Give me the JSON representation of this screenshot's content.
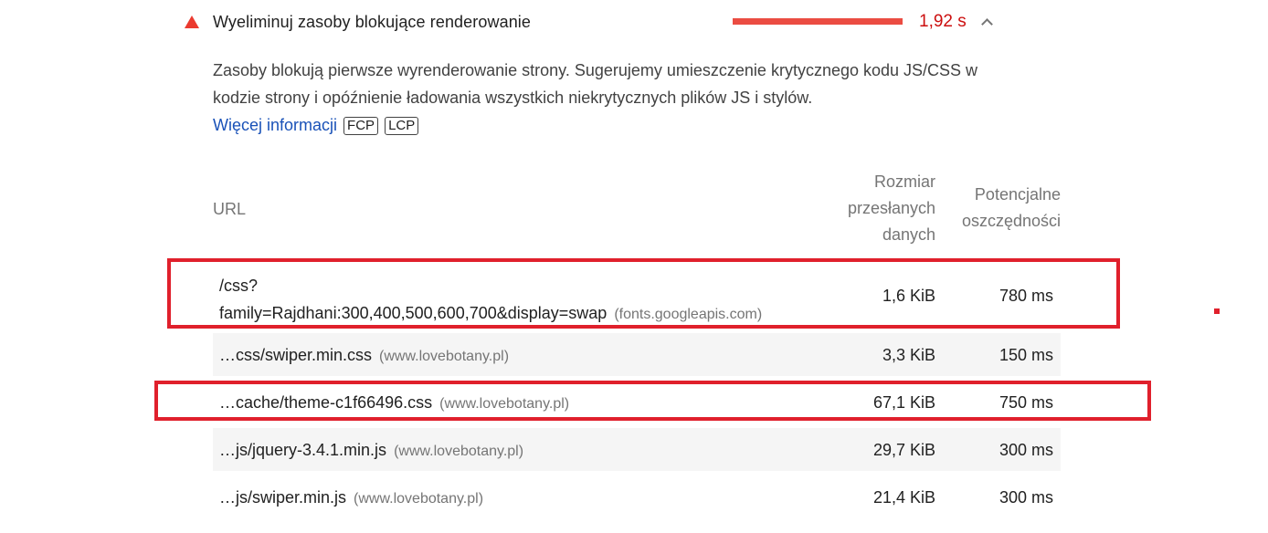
{
  "audit": {
    "title": "Wyeliminuj zasoby blokujące renderowanie",
    "savings": "1,92 s",
    "savings_fraction": 1.0,
    "status_icon": "warning-triangle-icon",
    "status_color": "#eb3a2f",
    "expand_icon": "chevron-up-icon"
  },
  "description": {
    "text": "Zasoby blokują pierwsze wyrenderowanie strony. Sugerujemy umieszczenie krytycznego kodu JS/CSS w kodzie strony i opóźnienie ładowania wszystkich niekrytycznych plików JS i stylów.",
    "link_label": "Więcej informacji",
    "tags": [
      "FCP",
      "LCP"
    ]
  },
  "table": {
    "headers": {
      "url": "URL",
      "size_line1": "Rozmiar",
      "size_line2": "przesłanych",
      "size_line3": "danych",
      "save_line1": "Potencjalne",
      "save_line2": "oszczędności"
    },
    "rows": [
      {
        "url_line1": "/css?",
        "url_line2": "family=Rajdhani:300,400,500,600,700&display=swap",
        "domain": "(fonts.googleapis.com)",
        "size": "1,6 KiB",
        "savings": "780 ms"
      },
      {
        "url": "…css/swiper.min.css",
        "domain": "(www.lovebotany.pl)",
        "size": "3,3 KiB",
        "savings": "150 ms"
      },
      {
        "url": "…cache/theme-c1f66496.css",
        "domain": "(www.lovebotany.pl)",
        "size": "67,1 KiB",
        "savings": "750 ms"
      },
      {
        "url": "…js/jquery-3.4.1.min.js",
        "domain": "(www.lovebotany.pl)",
        "size": "29,7 KiB",
        "savings": "300 ms"
      },
      {
        "url": "…js/swiper.min.js",
        "domain": "(www.lovebotany.pl)",
        "size": "21,4 KiB",
        "savings": "300 ms"
      }
    ]
  },
  "colors": {
    "highlight": "#e0202c",
    "link": "#1a52b8",
    "savings_text": "#cc0f0f",
    "bar": "#eb4c42"
  }
}
